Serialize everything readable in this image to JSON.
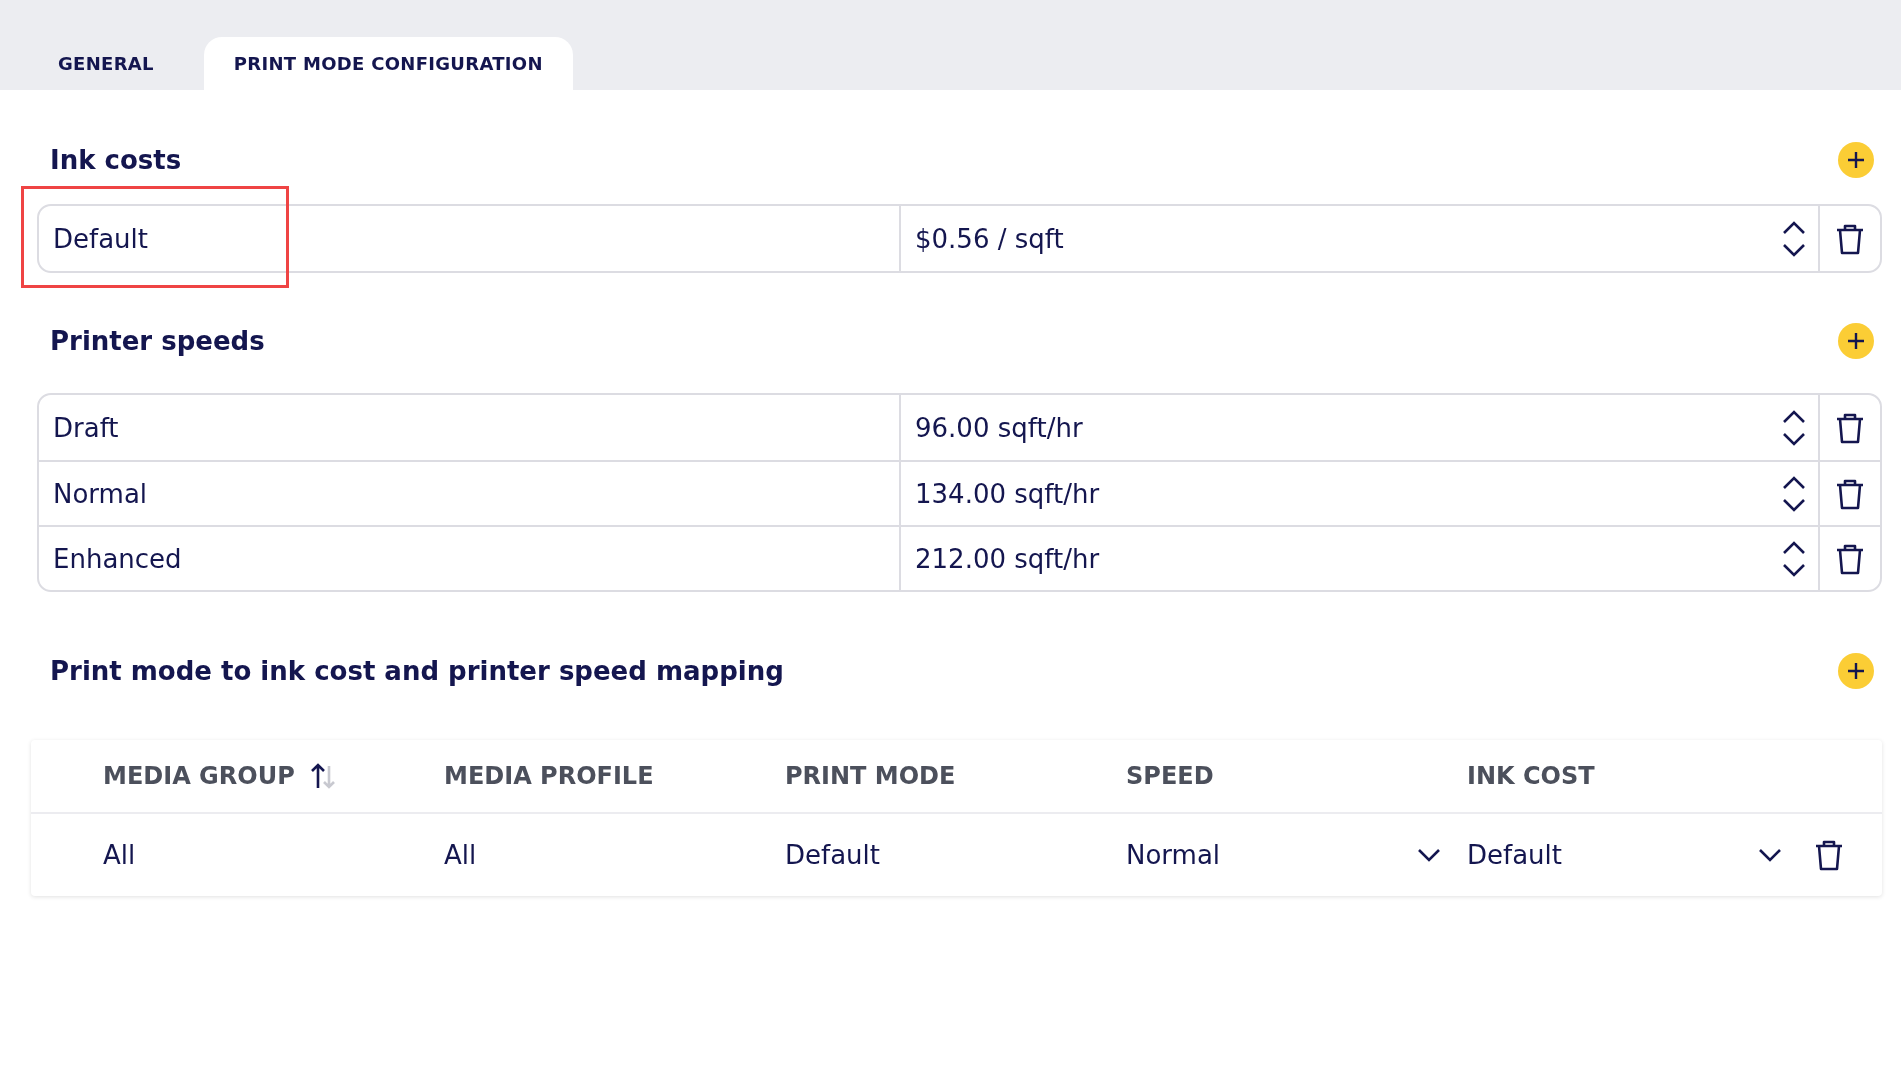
{
  "tabs": [
    {
      "label": "GENERAL",
      "selected": false
    },
    {
      "label": "PRINT MODE CONFIGURATION",
      "selected": true
    }
  ],
  "ink_costs": {
    "title": "Ink costs",
    "rows": [
      {
        "name": "Default",
        "value": "$0.56 / sqft",
        "highlighted": true
      }
    ]
  },
  "printer_speeds": {
    "title": "Printer speeds",
    "rows": [
      {
        "name": "Draft",
        "value": "96.00 sqft/hr",
        "highlighted": false
      },
      {
        "name": "Normal",
        "value": "134.00 sqft/hr",
        "highlighted": false
      },
      {
        "name": "Enhanced",
        "value": "212.00 sqft/hr",
        "highlighted": false
      }
    ]
  },
  "mapping": {
    "title": "Print mode to ink cost and printer speed mapping",
    "columns": [
      {
        "label": "MEDIA GROUP",
        "sorted": true
      },
      {
        "label": "MEDIA PROFILE",
        "sorted": false
      },
      {
        "label": "PRINT MODE",
        "sorted": false
      },
      {
        "label": "SPEED",
        "sorted": false
      },
      {
        "label": "INK COST",
        "sorted": false
      }
    ],
    "rows": [
      {
        "media_group": "All",
        "media_profile": "All",
        "print_mode": "Default",
        "speed": "Normal",
        "ink_cost": "Default"
      }
    ]
  }
}
